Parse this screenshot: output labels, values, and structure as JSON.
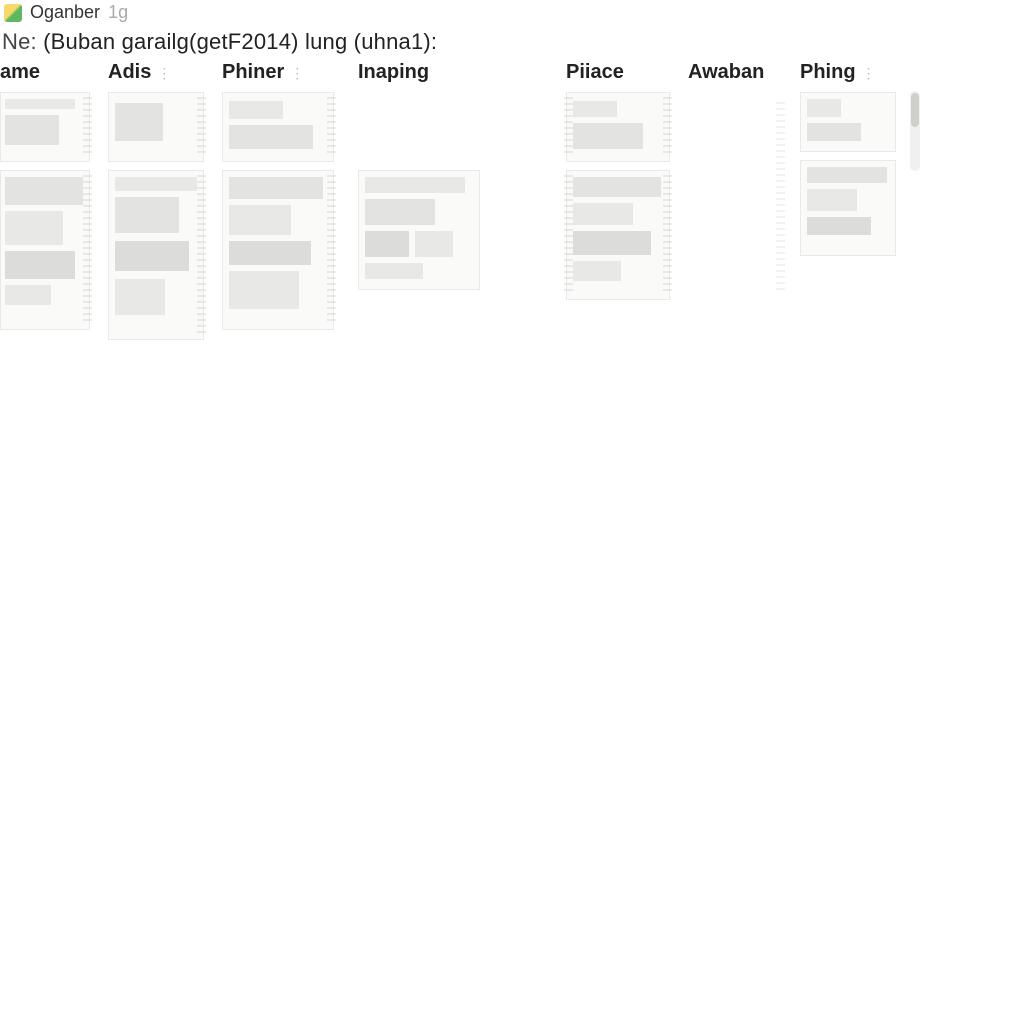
{
  "titlebar": {
    "app_name": "Oganber",
    "app_sub": "1g"
  },
  "expression": {
    "prefix": "Ne:",
    "body": "(Buban garailg(getF2014)  lung  (uhna1):"
  },
  "columns": [
    {
      "key": "ame",
      "label": "ame",
      "sortable": false
    },
    {
      "key": "adis",
      "label": "Adis",
      "sortable": true
    },
    {
      "key": "phiner",
      "label": "Phiner",
      "sortable": true
    },
    {
      "key": "inap",
      "label": "Inaping",
      "sortable": false
    },
    {
      "key": "piiace",
      "label": "Piiace",
      "sortable": false
    },
    {
      "key": "awaban",
      "label": "Awaban",
      "sortable": false
    },
    {
      "key": "phing",
      "label": "Phing",
      "sortable": true
    }
  ]
}
